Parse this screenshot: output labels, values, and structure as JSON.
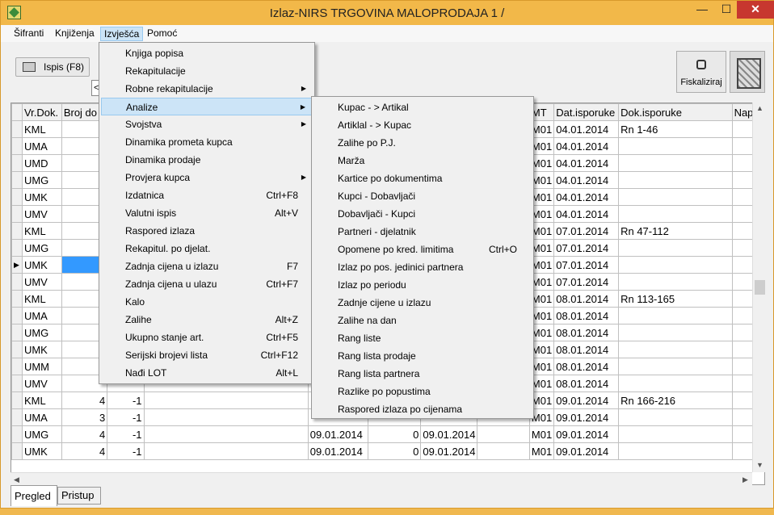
{
  "window": {
    "title": "Izlaz-NIRS TRGOVINA MALOPRODAJA 1 /",
    "min": "—",
    "max": "☐",
    "close": "✕"
  },
  "menubar": [
    "Šifranti",
    "Knjiženja",
    "Izvješća",
    "Pomoć"
  ],
  "toolbar": {
    "ispis": "Ispis (F8)",
    "field": "<",
    "fiskaliziraj": "Fiskaliziraj"
  },
  "table": {
    "headers": [
      "Vr.Dok.",
      "Broj do",
      "",
      "",
      "",
      "",
      "",
      "",
      "MT",
      "Dat.isporuke",
      "Dok.isporuke",
      "Nap"
    ],
    "rows": [
      {
        "vr": "KML",
        "b": "",
        "c": "",
        "d1": "",
        "q": "",
        "d2": "",
        "mt": "M01",
        "di": "04.01.2014",
        "dok": "Rn 1-46"
      },
      {
        "vr": "UMA",
        "b": "",
        "c": "",
        "d1": "",
        "q": "",
        "d2": "",
        "mt": "M01",
        "di": "04.01.2014",
        "dok": ""
      },
      {
        "vr": "UMD",
        "b": "",
        "c": "",
        "d1": "",
        "q": "",
        "d2": "",
        "mt": "M01",
        "di": "04.01.2014",
        "dok": ""
      },
      {
        "vr": "UMG",
        "b": "",
        "c": "",
        "d1": "",
        "q": "",
        "d2": "",
        "mt": "M01",
        "di": "04.01.2014",
        "dok": ""
      },
      {
        "vr": "UMK",
        "b": "",
        "c": "",
        "d1": "",
        "q": "",
        "d2": "",
        "mt": "M01",
        "di": "04.01.2014",
        "dok": ""
      },
      {
        "vr": "UMV",
        "b": "",
        "c": "",
        "d1": "",
        "q": "",
        "d2": "",
        "mt": "M01",
        "di": "04.01.2014",
        "dok": ""
      },
      {
        "vr": "KML",
        "b": "",
        "c": "",
        "d1": "",
        "q": "",
        "d2": "",
        "mt": "M01",
        "di": "07.01.2014",
        "dok": "Rn 47-112"
      },
      {
        "vr": "UMG",
        "b": "",
        "c": "",
        "d1": "",
        "q": "",
        "d2": "",
        "mt": "M01",
        "di": "07.01.2014",
        "dok": ""
      },
      {
        "vr": "UMK",
        "b": "",
        "c": "",
        "d1": "",
        "q": "",
        "d2": "",
        "mt": "M01",
        "di": "07.01.2014",
        "dok": ""
      },
      {
        "vr": "UMV",
        "b": "",
        "c": "",
        "d1": "",
        "q": "",
        "d2": "",
        "mt": "M01",
        "di": "07.01.2014",
        "dok": ""
      },
      {
        "vr": "KML",
        "b": "",
        "c": "",
        "d1": "",
        "q": "",
        "d2": "",
        "mt": "M01",
        "di": "08.01.2014",
        "dok": "Rn 113-165"
      },
      {
        "vr": "UMA",
        "b": "",
        "c": "",
        "d1": "",
        "q": "",
        "d2": "",
        "mt": "M01",
        "di": "08.01.2014",
        "dok": ""
      },
      {
        "vr": "UMG",
        "b": "",
        "c": "",
        "d1": "",
        "q": "",
        "d2": "",
        "mt": "M01",
        "di": "08.01.2014",
        "dok": ""
      },
      {
        "vr": "UMK",
        "b": "",
        "c": "",
        "d1": "",
        "q": "",
        "d2": "",
        "mt": "M01",
        "di": "08.01.2014",
        "dok": ""
      },
      {
        "vr": "UMM",
        "b": "",
        "c": "",
        "d1": "",
        "q": "",
        "d2": "",
        "mt": "M01",
        "di": "08.01.2014",
        "dok": ""
      },
      {
        "vr": "UMV",
        "b": "",
        "c": "",
        "d1": "",
        "q": "",
        "d2": "",
        "mt": "M01",
        "di": "08.01.2014",
        "dok": ""
      },
      {
        "vr": "KML",
        "b": "4",
        "c": "-1",
        "d1": "",
        "q": "",
        "d2": "",
        "mt": "M01",
        "di": "09.01.2014",
        "dok": "Rn 166-216"
      },
      {
        "vr": "UMA",
        "b": "3",
        "c": "-1",
        "d1": "",
        "q": "",
        "d2": "",
        "mt": "M01",
        "di": "09.01.2014",
        "dok": ""
      },
      {
        "vr": "UMG",
        "b": "4",
        "c": "-1",
        "d1": "09.01.2014",
        "q": "0",
        "d2": "09.01.2014",
        "mt": "M01",
        "di": "09.01.2014",
        "dok": ""
      },
      {
        "vr": "UMK",
        "b": "4",
        "c": "-1",
        "d1": "09.01.2014",
        "q": "0",
        "d2": "09.01.2014",
        "mt": "M01",
        "di": "09.01.2014",
        "dok": ""
      }
    ],
    "current_row": 8
  },
  "tabs": [
    "Pregled",
    "Pristup"
  ],
  "menu_izvjesca": [
    {
      "label": "Knjiga popisa",
      "sc": "",
      "sub": false
    },
    {
      "label": "Rekapitulacije",
      "sc": "",
      "sub": false
    },
    {
      "label": "Robne rekapitulacije",
      "sc": "",
      "sub": true
    },
    {
      "label": "Analize",
      "sc": "",
      "sub": true
    },
    {
      "label": "Svojstva",
      "sc": "",
      "sub": true
    },
    {
      "label": "Dinamika prometa kupca",
      "sc": "",
      "sub": false
    },
    {
      "label": "Dinamika prodaje",
      "sc": "",
      "sub": false
    },
    {
      "label": "Provjera kupca",
      "sc": "",
      "sub": true
    },
    {
      "label": "Izdatnica",
      "sc": "Ctrl+F8",
      "sub": false
    },
    {
      "label": "Valutni ispis",
      "sc": "Alt+V",
      "sub": false
    },
    {
      "label": "Raspored izlaza",
      "sc": "",
      "sub": false
    },
    {
      "label": "Rekapitul. po djelat.",
      "sc": "",
      "sub": false
    },
    {
      "label": "Zadnja cijena u izlazu",
      "sc": "F7",
      "sub": false
    },
    {
      "label": "Zadnja cijena u ulazu",
      "sc": "Ctrl+F7",
      "sub": false
    },
    {
      "label": "Kalo",
      "sc": "",
      "sub": false
    },
    {
      "label": "Zalihe",
      "sc": "Alt+Z",
      "sub": false
    },
    {
      "label": "Ukupno stanje art.",
      "sc": "Ctrl+F5",
      "sub": false
    },
    {
      "label": "Serijski brojevi lista",
      "sc": "Ctrl+F12",
      "sub": false
    },
    {
      "label": "Nađi LOT",
      "sc": "Alt+L",
      "sub": false
    }
  ],
  "menu_analize": [
    {
      "label": "Kupac - > Artikal",
      "sc": ""
    },
    {
      "label": "Artiklal - > Kupac",
      "sc": ""
    },
    {
      "label": "Zalihe po P.J.",
      "sc": ""
    },
    {
      "label": "Marža",
      "sc": ""
    },
    {
      "label": "Kartice po dokumentima",
      "sc": ""
    },
    {
      "label": "Kupci - Dobavljači",
      "sc": ""
    },
    {
      "label": "Dobavljači - Kupci",
      "sc": ""
    },
    {
      "label": "Partneri - djelatnik",
      "sc": ""
    },
    {
      "label": "Opomene po kred. limitima",
      "sc": "Ctrl+O"
    },
    {
      "label": "Izlaz po pos. jedinici partnera",
      "sc": ""
    },
    {
      "label": "Izlaz po periodu",
      "sc": ""
    },
    {
      "label": "Zadnje cijene u izlazu",
      "sc": ""
    },
    {
      "label": "Zalihe na dan",
      "sc": ""
    },
    {
      "label": "Rang liste",
      "sc": ""
    },
    {
      "label": "Rang lista prodaje",
      "sc": ""
    },
    {
      "label": "Rang lista partnera",
      "sc": ""
    },
    {
      "label": "Razlike po popustima",
      "sc": ""
    },
    {
      "label": "Raspored izlaza po cijenama",
      "sc": ""
    }
  ],
  "highlighted_menu_index": 3
}
